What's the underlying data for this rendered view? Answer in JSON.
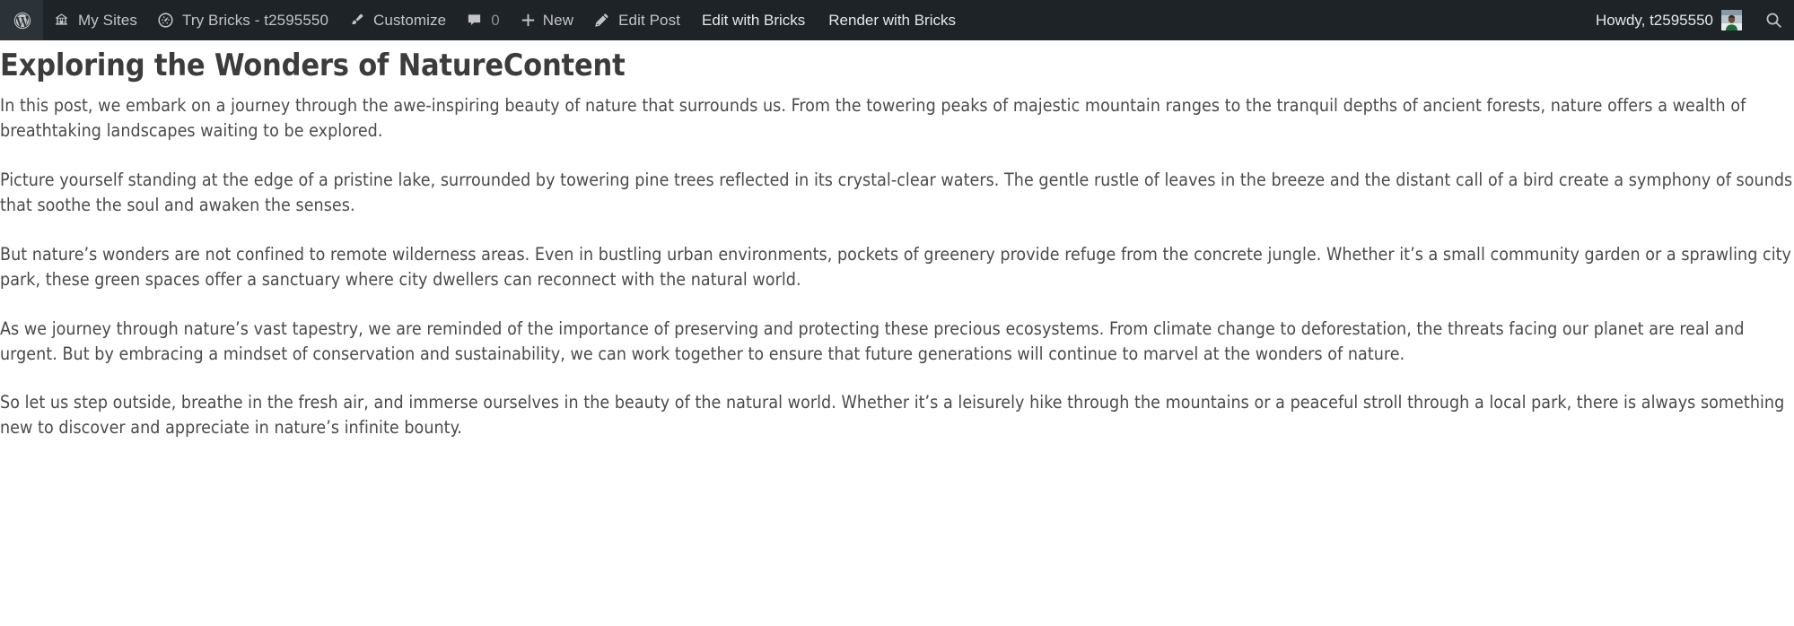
{
  "adminbar": {
    "background_color": "#1d2327",
    "text_color": "#c3c4c7",
    "left_items": [
      {
        "id": "wp-logo",
        "icon": "wordpress-logo-icon",
        "label": ""
      },
      {
        "id": "my-sites",
        "icon": "network-sites-icon",
        "label": "My Sites"
      },
      {
        "id": "site-name",
        "icon": "dashboard-gauge-icon",
        "label": "Try Bricks - t2595550"
      },
      {
        "id": "customize",
        "icon": "paintbrush-icon",
        "label": "Customize"
      },
      {
        "id": "comments",
        "icon": "comment-bubble-icon",
        "label": "0"
      },
      {
        "id": "new-content",
        "icon": "plus-icon",
        "label": "New"
      },
      {
        "id": "edit-post",
        "icon": "pencil-icon",
        "label": "Edit Post"
      }
    ],
    "plain_items": [
      {
        "id": "edit-with-bricks",
        "label": "Edit with Bricks"
      },
      {
        "id": "render-with-bricks",
        "label": "Render with Bricks"
      }
    ],
    "account": {
      "greeting": "Howdy, t2595550",
      "avatar_icon": "user-avatar-image",
      "search_icon": "search-icon"
    }
  },
  "post": {
    "title": "Exploring the Wonders of NatureContent",
    "paragraphs": [
      "In this post, we embark on a journey through the awe-inspiring beauty of nature that surrounds us. From the towering peaks of majestic mountain ranges to the tranquil depths of ancient forests, nature offers a wealth of breathtaking landscapes waiting to be explored.",
      "Picture yourself standing at the edge of a pristine lake, surrounded by towering pine trees reflected in its crystal-clear waters. The gentle rustle of leaves in the breeze and the distant call of a bird create a symphony of sounds that soothe the soul and awaken the senses.",
      "But nature’s wonders are not confined to remote wilderness areas. Even in bustling urban environments, pockets of greenery provide refuge from the concrete jungle. Whether it’s a small community garden or a sprawling city park, these green spaces offer a sanctuary where city dwellers can reconnect with the natural world.",
      "As we journey through nature’s vast tapestry, we are reminded of the importance of preserving and protecting these precious ecosystems. From climate change to deforestation, the threats facing our planet are real and urgent. But by embracing a mindset of conservation and sustainability, we can work together to ensure that future generations will continue to marvel at the wonders of nature.",
      "So let us step outside, breathe in the fresh air, and immerse ourselves in the beauty of the natural world. Whether it’s a leisurely hike through the mountains or a peaceful stroll through a local park, there is always something new to discover and appreciate in nature’s infinite bounty."
    ]
  },
  "colors": {
    "admin_bar_bg": "#1d2327",
    "admin_bar_text": "#c3c4c7",
    "body_text": "#4a4a4a",
    "title_text": "#3c3c3c",
    "page_bg": "#ffffff"
  }
}
